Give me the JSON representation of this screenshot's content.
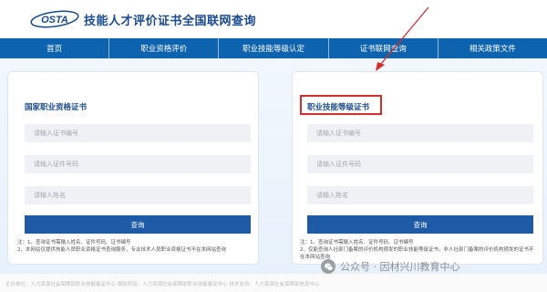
{
  "header": {
    "logo_text": "OSTA",
    "title": "技能人才评价证书全国联网查询"
  },
  "nav": {
    "items": [
      {
        "label": "首页"
      },
      {
        "label": "职业资格评价"
      },
      {
        "label": "职业技能等级认定"
      },
      {
        "label": "证书联网查询"
      },
      {
        "label": "相关政策文件"
      }
    ]
  },
  "left_card": {
    "title": "国家职业资格证书",
    "cert_number_placeholder": "请输入证书编号",
    "id_number_placeholder": "请输入证件号码",
    "name_placeholder": "请输入姓名",
    "button_label": "查询",
    "note_1": "注：1、查询证书需输入姓名、证件号码、证书编号",
    "note_2": "2、本网站仅提供技能人员职业资格证书查询服务，专业技术人员职业资格证书不在本网站查询"
  },
  "right_card": {
    "title": "职业技能等级证书",
    "cert_number_placeholder": "请输入证书编号",
    "id_number_placeholder": "请输入证件号码",
    "name_placeholder": "请输入姓名",
    "button_label": "查询",
    "note_1": "注：1、查询证书需输入姓名、证件号码、证书编号",
    "note_2": "2、仅能查询人社部门备案的评价机构颁发的职业技能等级证书，非人社部门备案的评价机构颁发的证书不在本网站查询"
  },
  "watermark": {
    "text": "公众号 · 因材兴川教育中心"
  },
  "footer": {
    "text": "主办单位：人力资源社会保障部职业技能鉴定中心   版权所有：人力资源社会保障部职业技能鉴定中心   技术支持：人力资源社会保障部信息中心"
  },
  "colors": {
    "nav_bg": "#0d63ad",
    "title_blue": "#1a4a8f",
    "button_bg": "#1e5aa5",
    "highlight_red": "#d62d2d"
  }
}
